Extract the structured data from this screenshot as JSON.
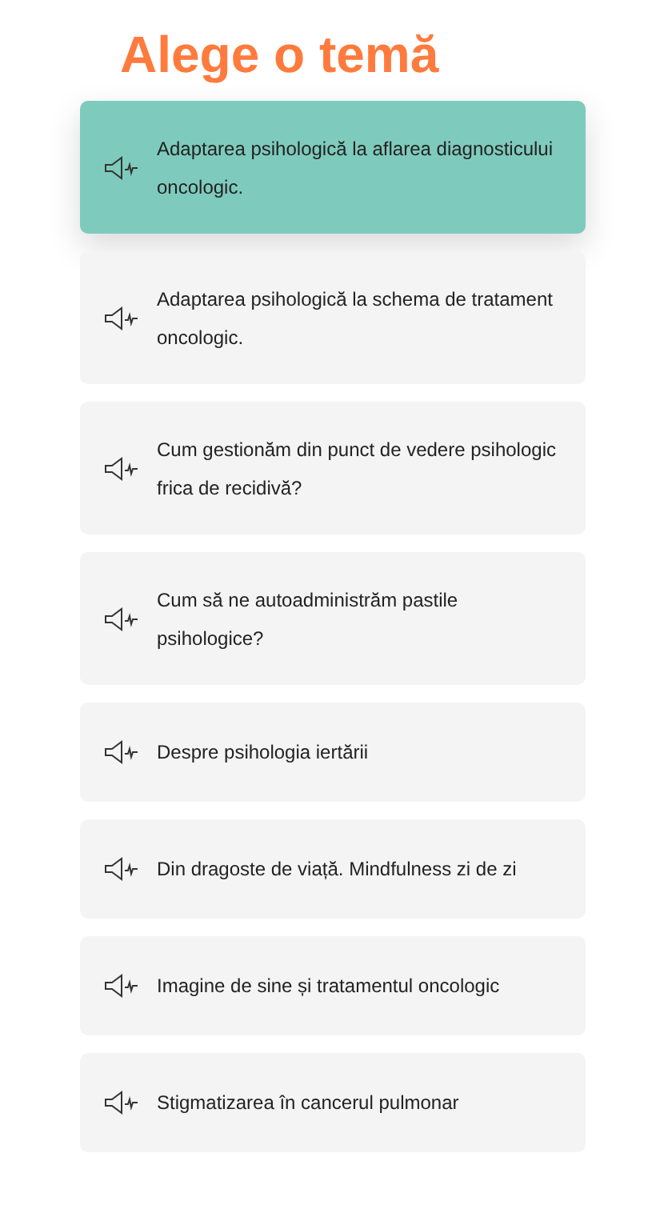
{
  "title": "Alege o temă",
  "topics": [
    {
      "label": "Adaptarea psihologică la aflarea diagnosticului oncologic.",
      "selected": true
    },
    {
      "label": "Adaptarea psihologică la schema de tratament oncologic.",
      "selected": false
    },
    {
      "label": "Cum gestionăm din punct de vedere psihologic frica de recidivă?",
      "selected": false
    },
    {
      "label": "Cum să ne autoadministrăm pastile psihologice?",
      "selected": false
    },
    {
      "label": "Despre psihologia iertării",
      "selected": false
    },
    {
      "label": "Din dragoste de viață. Mindfulness zi de zi",
      "selected": false
    },
    {
      "label": "Imagine de sine și tratamentul oncologic",
      "selected": false
    },
    {
      "label": "Stigmatizarea în cancerul pulmonar",
      "selected": false
    }
  ]
}
